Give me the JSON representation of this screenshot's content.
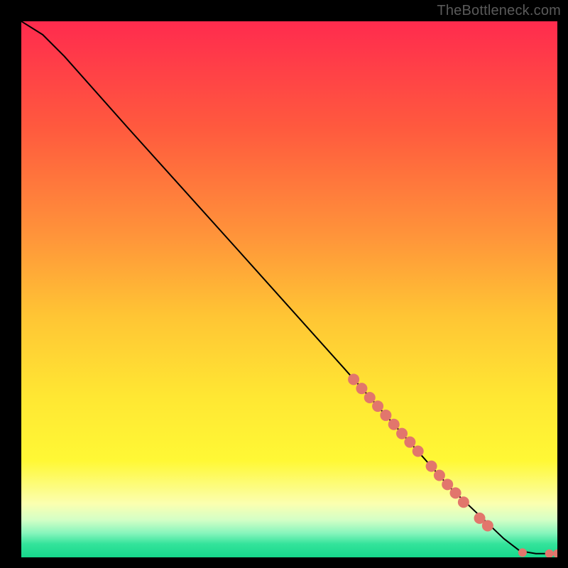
{
  "watermark": "TheBottleneck.com",
  "chart_data": {
    "type": "line",
    "title": "",
    "xlabel": "",
    "ylabel": "",
    "xlim": [
      0,
      100
    ],
    "ylim": [
      0,
      100
    ],
    "background_gradient": {
      "stops": [
        {
          "offset": 0.0,
          "color": "#ff2b4e"
        },
        {
          "offset": 0.2,
          "color": "#ff5a3e"
        },
        {
          "offset": 0.4,
          "color": "#ff943a"
        },
        {
          "offset": 0.55,
          "color": "#ffc534"
        },
        {
          "offset": 0.7,
          "color": "#ffe733"
        },
        {
          "offset": 0.82,
          "color": "#fff835"
        },
        {
          "offset": 0.9,
          "color": "#fbffb0"
        },
        {
          "offset": 0.93,
          "color": "#d4ffc6"
        },
        {
          "offset": 0.955,
          "color": "#86f5bc"
        },
        {
          "offset": 0.975,
          "color": "#34e39b"
        },
        {
          "offset": 1.0,
          "color": "#16d88b"
        }
      ]
    },
    "curve": [
      {
        "x": 0.0,
        "y": 100.0
      },
      {
        "x": 4.0,
        "y": 97.5
      },
      {
        "x": 8.0,
        "y": 93.5
      },
      {
        "x": 20.0,
        "y": 80.0
      },
      {
        "x": 40.0,
        "y": 57.8
      },
      {
        "x": 60.0,
        "y": 35.5
      },
      {
        "x": 80.0,
        "y": 13.0
      },
      {
        "x": 90.0,
        "y": 3.5
      },
      {
        "x": 93.0,
        "y": 1.2
      },
      {
        "x": 96.0,
        "y": 0.7
      },
      {
        "x": 100.0,
        "y": 0.7
      }
    ],
    "markers_on_curve": [
      {
        "x": 62.0,
        "y": 33.2
      },
      {
        "x": 63.5,
        "y": 31.5
      },
      {
        "x": 65.0,
        "y": 29.8
      },
      {
        "x": 66.5,
        "y": 28.2
      },
      {
        "x": 68.0,
        "y": 26.5
      },
      {
        "x": 69.5,
        "y": 24.8
      },
      {
        "x": 71.0,
        "y": 23.1
      },
      {
        "x": 72.5,
        "y": 21.5
      },
      {
        "x": 74.0,
        "y": 19.8
      },
      {
        "x": 76.5,
        "y": 17.0
      },
      {
        "x": 78.0,
        "y": 15.3
      },
      {
        "x": 79.5,
        "y": 13.6
      },
      {
        "x": 81.0,
        "y": 12.0
      },
      {
        "x": 82.5,
        "y": 10.3
      },
      {
        "x": 85.5,
        "y": 7.3
      },
      {
        "x": 87.0,
        "y": 5.9
      }
    ],
    "markers_flat": [
      {
        "x": 93.5,
        "y": 0.9
      },
      {
        "x": 98.5,
        "y": 0.7
      },
      {
        "x": 100.0,
        "y": 0.7
      }
    ],
    "marker_style": {
      "fill": "#e2766c",
      "radius_curve": 8,
      "radius_flat": 6
    },
    "line_style": {
      "stroke": "#000000",
      "width": 2
    }
  }
}
